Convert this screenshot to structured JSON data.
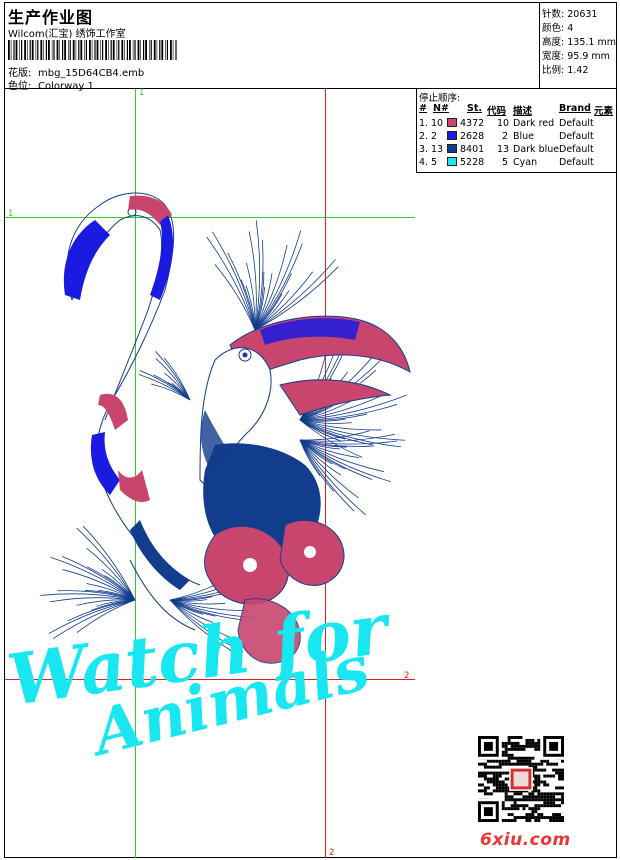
{
  "header": {
    "title": "生产作业图",
    "company": "Wilcom(汇宝) 绣饰工作室",
    "design_label": "花版:",
    "design_value": "mbg_15D64CB4.emb",
    "colorway_label": "色位:",
    "colorway_value": "Colorway 1"
  },
  "stats": [
    {
      "label": "针数:",
      "value": "20631"
    },
    {
      "label": "颜色:",
      "value": "4"
    },
    {
      "label": "高度:",
      "value": "135.1 mm"
    },
    {
      "label": "宽度:",
      "value": "95.9 mm"
    },
    {
      "label": "比例:",
      "value": "1.42"
    }
  ],
  "stop_sequence": {
    "title": "停止顺序:",
    "headers": [
      "#",
      "N#",
      "St.",
      "代码",
      "描述",
      "Brand",
      "元素"
    ],
    "rows": [
      {
        "idx": "1.",
        "n": "10",
        "stitches": "4372",
        "code": "10",
        "desc": "Dark red",
        "brand": "Default",
        "color": "#c8466e"
      },
      {
        "idx": "2.",
        "n": "2",
        "stitches": "2628",
        "code": "2",
        "desc": "Blue",
        "brand": "Default",
        "color": "#1a1ae0"
      },
      {
        "idx": "3.",
        "n": "13",
        "stitches": "8401",
        "code": "13",
        "desc": "Dark blue",
        "brand": "Default",
        "color": "#123c8c"
      },
      {
        "idx": "4.",
        "n": "5",
        "stitches": "5228",
        "code": "5",
        "desc": "Cyan",
        "brand": "Default",
        "color": "#18e6f0"
      }
    ]
  },
  "guides": {
    "marker_1": "1",
    "marker_2": "2"
  },
  "artwork": {
    "text_line1": "Watch for",
    "text_line2": "Animals",
    "text_color": "#18e6f0"
  },
  "watermark": {
    "text": "6xiu.com",
    "color": "#e33333"
  }
}
